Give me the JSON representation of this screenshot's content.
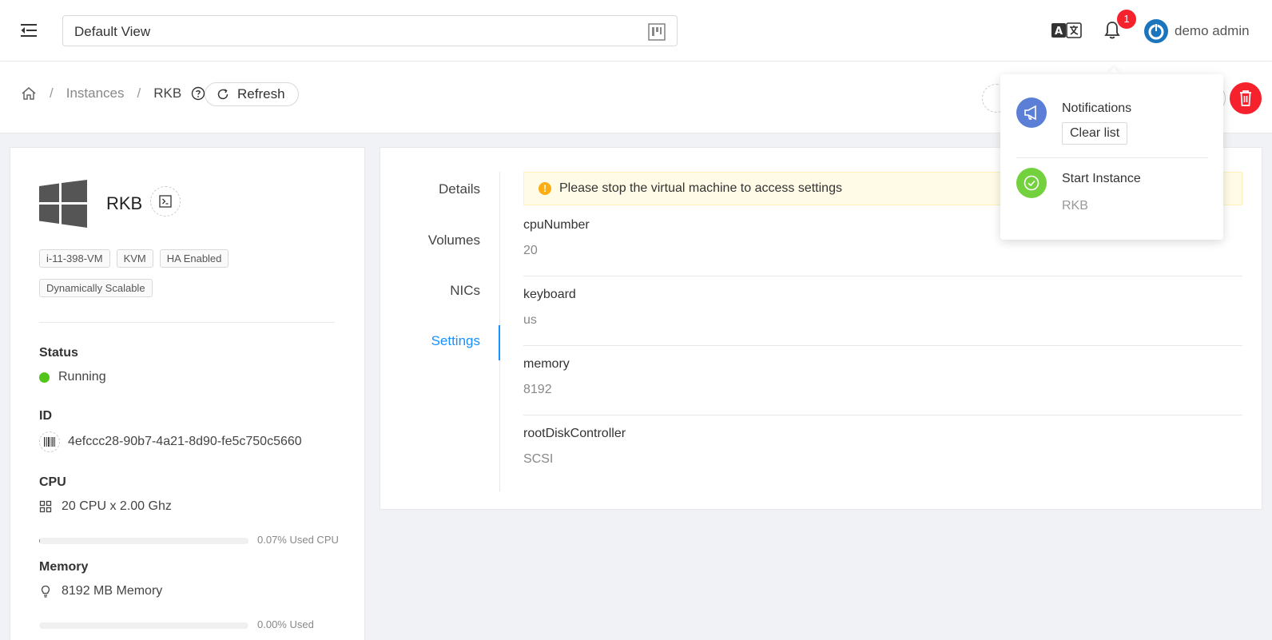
{
  "header": {
    "view_select_value": "Default View",
    "notification_count": "1",
    "user_name": "demo admin"
  },
  "breadcrumb": {
    "items": [
      "Instances",
      "RKB"
    ],
    "separator": "/",
    "refresh_label": "Refresh"
  },
  "vm": {
    "name": "RKB",
    "tags": [
      "i-11-398-VM",
      "KVM",
      "HA Enabled",
      "Dynamically Scalable"
    ],
    "status_label": "Status",
    "status_value": "Running",
    "id_label": "ID",
    "id_value": "4efccc28-90b7-4a21-8d90-fe5c750c5660",
    "cpu_label": "CPU",
    "cpu_value": "20 CPU x 2.00 Ghz",
    "cpu_used_label": "0.07% Used CPU",
    "cpu_used_percent": 0.07,
    "memory_label": "Memory",
    "memory_value": "8192 MB Memory",
    "memory_used_label": "0.00% Used",
    "memory_used_percent": 0.0
  },
  "tabs": [
    "Details",
    "Volumes",
    "NICs",
    "Settings"
  ],
  "active_tab": "Settings",
  "alert_text": "Please stop the virtual machine to access settings",
  "settings": [
    {
      "key": "cpuNumber",
      "value": "20"
    },
    {
      "key": "keyboard",
      "value": "us"
    },
    {
      "key": "memory",
      "value": "8192"
    },
    {
      "key": "rootDiskController",
      "value": "SCSI"
    }
  ],
  "notifications": {
    "title": "Notifications",
    "clear_label": "Clear list",
    "items": [
      {
        "title": "Start Instance",
        "subtitle": "RKB"
      }
    ]
  },
  "colors": {
    "accent": "#1890ff",
    "danger": "#f5222d",
    "success": "#52c41a",
    "warning": "#faad14",
    "notif_icon_bg": "#5b7fd6",
    "success_icon_bg": "#73d13d"
  }
}
